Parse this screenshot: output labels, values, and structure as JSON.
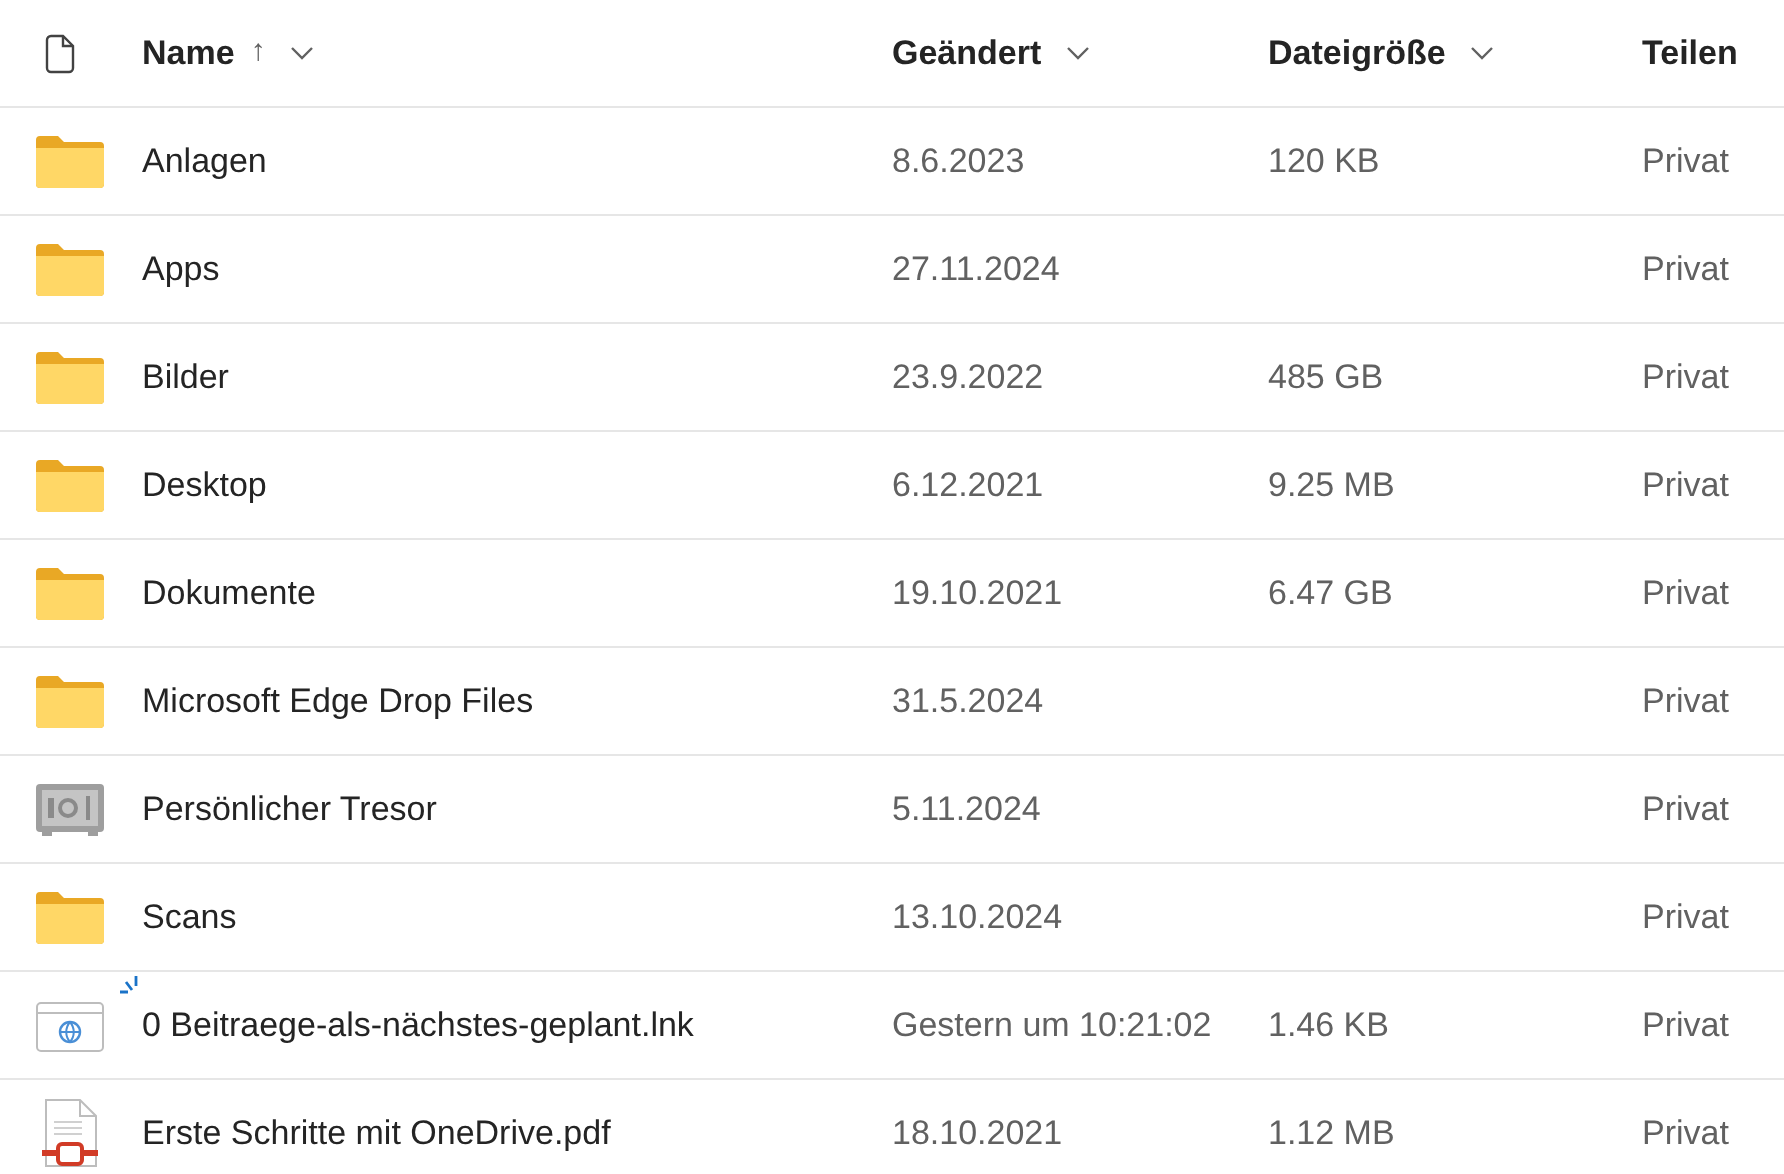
{
  "columns": [
    {
      "kind": "type"
    },
    {
      "kind": "text",
      "label": "Name",
      "sort_indicator": "↑",
      "menu": true
    },
    {
      "kind": "text",
      "label": "Geändert",
      "menu": true
    },
    {
      "kind": "text",
      "label": "Dateigröße",
      "menu": true
    },
    {
      "kind": "text",
      "label": "Teilen",
      "menu": false
    }
  ],
  "rows": [
    {
      "kind": "folder",
      "name": "Anlagen",
      "modified": "8.6.2023",
      "size": "120 KB",
      "sharing": "Privat"
    },
    {
      "kind": "folder",
      "name": "Apps",
      "modified": "27.11.2024",
      "sharing": "Privat"
    },
    {
      "kind": "folder",
      "name": "Bilder",
      "modified": "23.9.2022",
      "size": "485 GB",
      "sharing": "Privat"
    },
    {
      "kind": "folder",
      "name": "Desktop",
      "modified": "6.12.2021",
      "size": "9.25 MB",
      "sharing": "Privat"
    },
    {
      "kind": "folder",
      "name": "Dokumente",
      "modified": "19.10.2021",
      "size": "6.47 GB",
      "sharing": "Privat"
    },
    {
      "kind": "folder",
      "name": "Microsoft Edge Drop Files",
      "modified": "31.5.2024",
      "sharing": "Privat"
    },
    {
      "kind": "vault",
      "name": "Persönlicher Tresor",
      "modified": "5.11.2024",
      "sharing": "Privat"
    },
    {
      "kind": "folder",
      "name": "Scans",
      "modified": "13.10.2024",
      "sharing": "Privat"
    },
    {
      "kind": "link",
      "name": "0 Beitraege-als-nächstes-geplant.lnk",
      "new": true,
      "modified": "Gestern um 10:21:02",
      "size": "1.46 KB",
      "sharing": "Privat"
    },
    {
      "kind": "pdf",
      "name": "Erste Schritte mit OneDrive.pdf",
      "modified": "18.10.2021",
      "size": "1.12 MB",
      "sharing": "Privat"
    }
  ]
}
